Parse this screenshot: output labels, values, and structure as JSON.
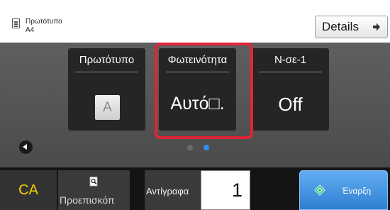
{
  "header": {
    "original_label": "Πρωτότυπο",
    "original_size": "A4",
    "details_label": "Details",
    "icons": [
      "original-document-icon",
      "arrow-right-icon"
    ]
  },
  "tiles": [
    {
      "label": "Πρωτότυπο",
      "value": "A"
    },
    {
      "label": "Φωτεινότητα",
      "value": "Αυτό□."
    },
    {
      "label": "N-σε-1",
      "value": "Off"
    }
  ],
  "pagination": {
    "page_count": 2,
    "active_page": 2
  },
  "bottom_bar": {
    "ca_label": "CA",
    "preview_label": "Προεπισκόπ",
    "copies_label": "Αντίγραφα",
    "copies_value": "1",
    "start_label": "Έναρξη"
  },
  "colors": {
    "highlight": "#e0253a",
    "ca_text": "#f5d200",
    "start_button": "#3b8ee0",
    "active_dot": "#2f8ff0"
  }
}
